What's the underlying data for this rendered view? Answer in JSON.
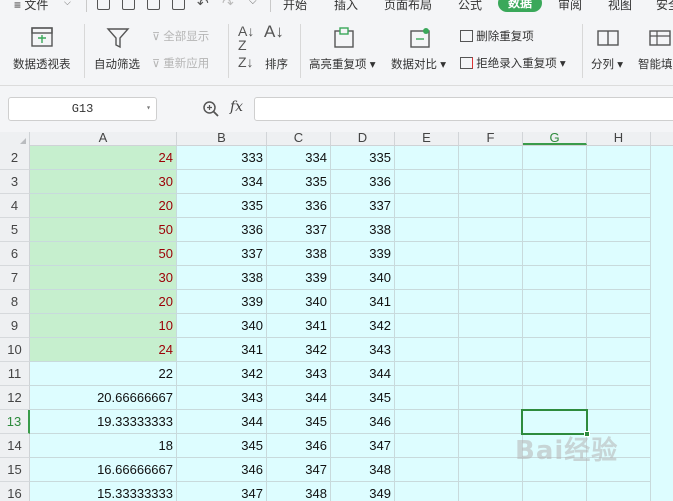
{
  "menu": {
    "file": "≡ 文件",
    "tabs": [
      "开始",
      "插入",
      "页面布局",
      "公式",
      "数据",
      "审阅",
      "视图",
      "安全"
    ],
    "active_tab": "数据"
  },
  "ribbon": {
    "pivot": "数据透视表",
    "autofilter": "自动筛选",
    "show_all": "全部显示",
    "reapply": "重新应用",
    "sort": "排序",
    "highlight_dup": "高亮重复项",
    "compare": "数据对比",
    "remove_dup": "删除重复项",
    "reject_dup": "拒绝录入重复项",
    "split": "分列",
    "smart_fill": "智能填"
  },
  "formula_bar": {
    "name_box": "G13",
    "fx": "fx",
    "formula": ""
  },
  "columns": [
    "A",
    "B",
    "C",
    "D",
    "E",
    "F",
    "G",
    "H"
  ],
  "selected_column": "G",
  "selected_row": "13",
  "rows": [
    {
      "num": "2",
      "a": "24",
      "b": "333",
      "c": "334",
      "d": "335",
      "hl": true
    },
    {
      "num": "3",
      "a": "30",
      "b": "334",
      "c": "335",
      "d": "336",
      "hl": true
    },
    {
      "num": "4",
      "a": "20",
      "b": "335",
      "c": "336",
      "d": "337",
      "hl": true
    },
    {
      "num": "5",
      "a": "50",
      "b": "336",
      "c": "337",
      "d": "338",
      "hl": true
    },
    {
      "num": "6",
      "a": "50",
      "b": "337",
      "c": "338",
      "d": "339",
      "hl": true
    },
    {
      "num": "7",
      "a": "30",
      "b": "338",
      "c": "339",
      "d": "340",
      "hl": true
    },
    {
      "num": "8",
      "a": "20",
      "b": "339",
      "c": "340",
      "d": "341",
      "hl": true
    },
    {
      "num": "9",
      "a": "10",
      "b": "340",
      "c": "341",
      "d": "342",
      "hl": true
    },
    {
      "num": "10",
      "a": "24",
      "b": "341",
      "c": "342",
      "d": "343",
      "hl": true
    },
    {
      "num": "11",
      "a": "22",
      "b": "342",
      "c": "343",
      "d": "344",
      "hl": false
    },
    {
      "num": "12",
      "a": "20.66666667",
      "b": "343",
      "c": "344",
      "d": "345",
      "hl": false
    },
    {
      "num": "13",
      "a": "19.33333333",
      "b": "344",
      "c": "345",
      "d": "346",
      "hl": false
    },
    {
      "num": "14",
      "a": "18",
      "b": "345",
      "c": "346",
      "d": "347",
      "hl": false
    },
    {
      "num": "15",
      "a": "16.66666667",
      "b": "346",
      "c": "347",
      "d": "348",
      "hl": false
    },
    {
      "num": "16",
      "a": "15.33333333",
      "b": "347",
      "c": "348",
      "d": "349",
      "hl": false
    }
  ],
  "watermark": "Bai经验",
  "colors": {
    "accent": "#3aa85a",
    "highlight_fill": "#c6efce",
    "highlight_text": "#9c0006",
    "sheet_bg": "#ddfdff"
  }
}
